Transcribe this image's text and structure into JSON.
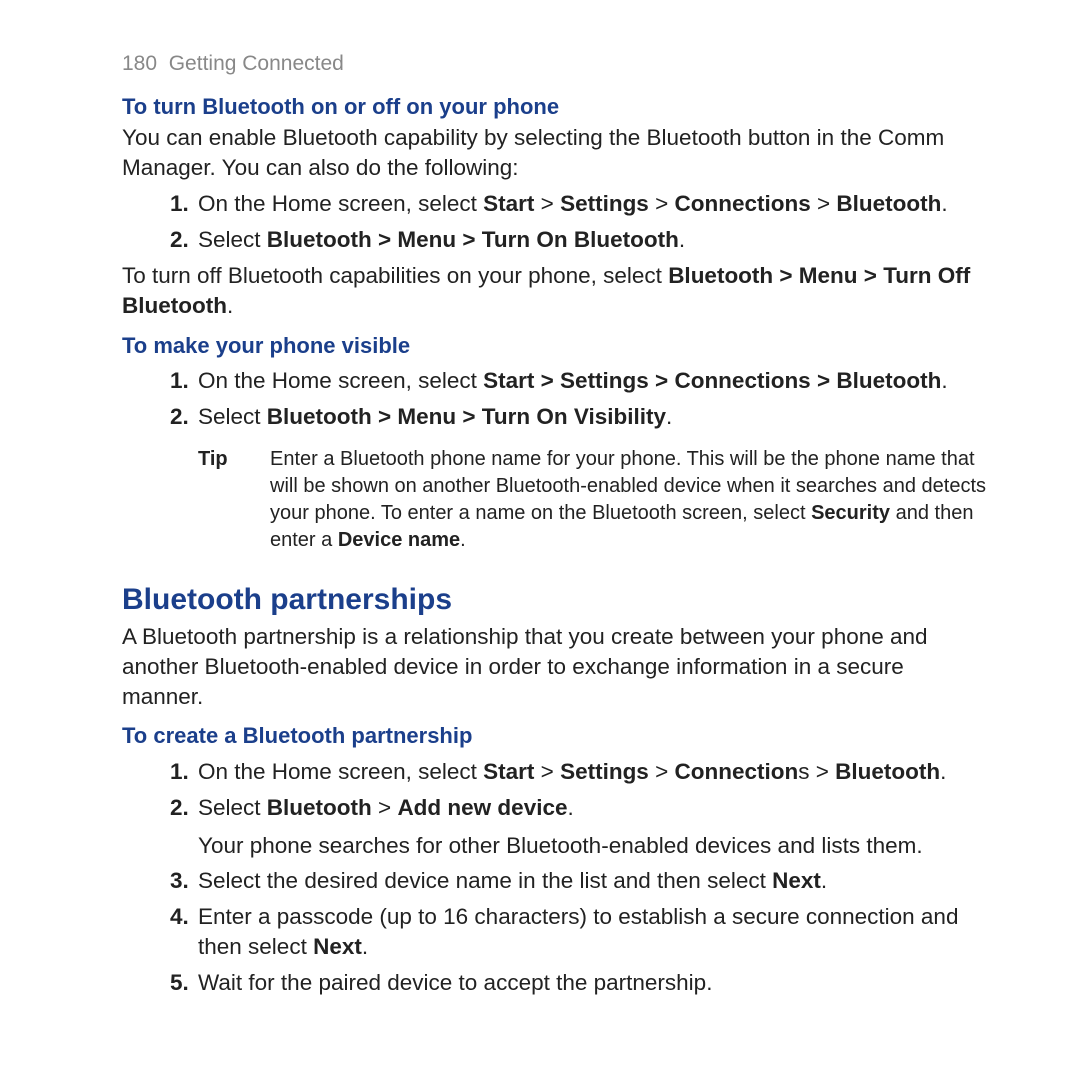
{
  "header": {
    "page": "180",
    "section": "Getting Connected"
  },
  "s1": {
    "title": "To turn Bluetooth on or off on your phone",
    "intro": "You can enable Bluetooth capability by selecting the Bluetooth button in the Comm Manager. You can also do the following:",
    "step1": {
      "num": "1.",
      "pre": "On the Home screen, select ",
      "b1": "Start",
      "s1": " > ",
      "b2": "Settings",
      "s2": " > ",
      "b3": "Connections",
      "s3": " > ",
      "b4": "Bluetooth",
      "post": "."
    },
    "step2": {
      "num": "2.",
      "pre": "Select ",
      "b1": "Bluetooth > Menu > Turn On Bluetooth",
      "post": "."
    },
    "off": {
      "pre": "To turn off Bluetooth capabilities on your phone, select ",
      "b1": "Bluetooth > Menu > Turn Off Bluetooth",
      "post": "."
    }
  },
  "s2": {
    "title": "To make your phone visible",
    "step1": {
      "num": "1.",
      "pre": "On the Home screen, select ",
      "b1": "Start > Settings > Connections > Bluetooth",
      "post": "."
    },
    "step2": {
      "num": "2.",
      "pre": "Select ",
      "b1": "Bluetooth > Menu > Turn On Visibility",
      "post": "."
    },
    "tip": {
      "label": "Tip",
      "pre": "Enter a Bluetooth phone name for your phone. This will be the phone name that will be shown on another Bluetooth-enabled device when it searches and detects your phone. To enter a name on the Bluetooth screen, select ",
      "b1": "Security",
      "mid": " and then enter a ",
      "b2": "Device name",
      "post": "."
    }
  },
  "s3": {
    "title": "Bluetooth partnerships",
    "intro": "A Bluetooth partnership is a relationship that you create between your phone and another Bluetooth-enabled device in order to exchange information in a secure manner.",
    "subtitle": "To create a Bluetooth partnership",
    "st1": {
      "num": "1.",
      "pre": "On the Home screen, select ",
      "b1": "Start",
      "s1": " > ",
      "b2": "Settings",
      "s2": " > ",
      "b3": "Connection",
      "mid": "s > ",
      "b4": "Bluetooth",
      "post": "."
    },
    "st2": {
      "num": "2.",
      "pre": "Select ",
      "b1": "Bluetooth",
      "s1": " > ",
      "b2": "Add new device",
      "post": ".",
      "body": "Your phone searches for other Bluetooth-enabled devices and lists them."
    },
    "st3": {
      "num": "3.",
      "pre": "Select the desired device name in the list and then select ",
      "b1": "Next",
      "post": "."
    },
    "st4": {
      "num": "4.",
      "pre": "Enter a passcode (up to 16 characters) to establish a secure connection and then select ",
      "b1": "Next",
      "post": "."
    },
    "st5": {
      "num": "5.",
      "text": "Wait for the paired device to accept the partnership."
    }
  }
}
